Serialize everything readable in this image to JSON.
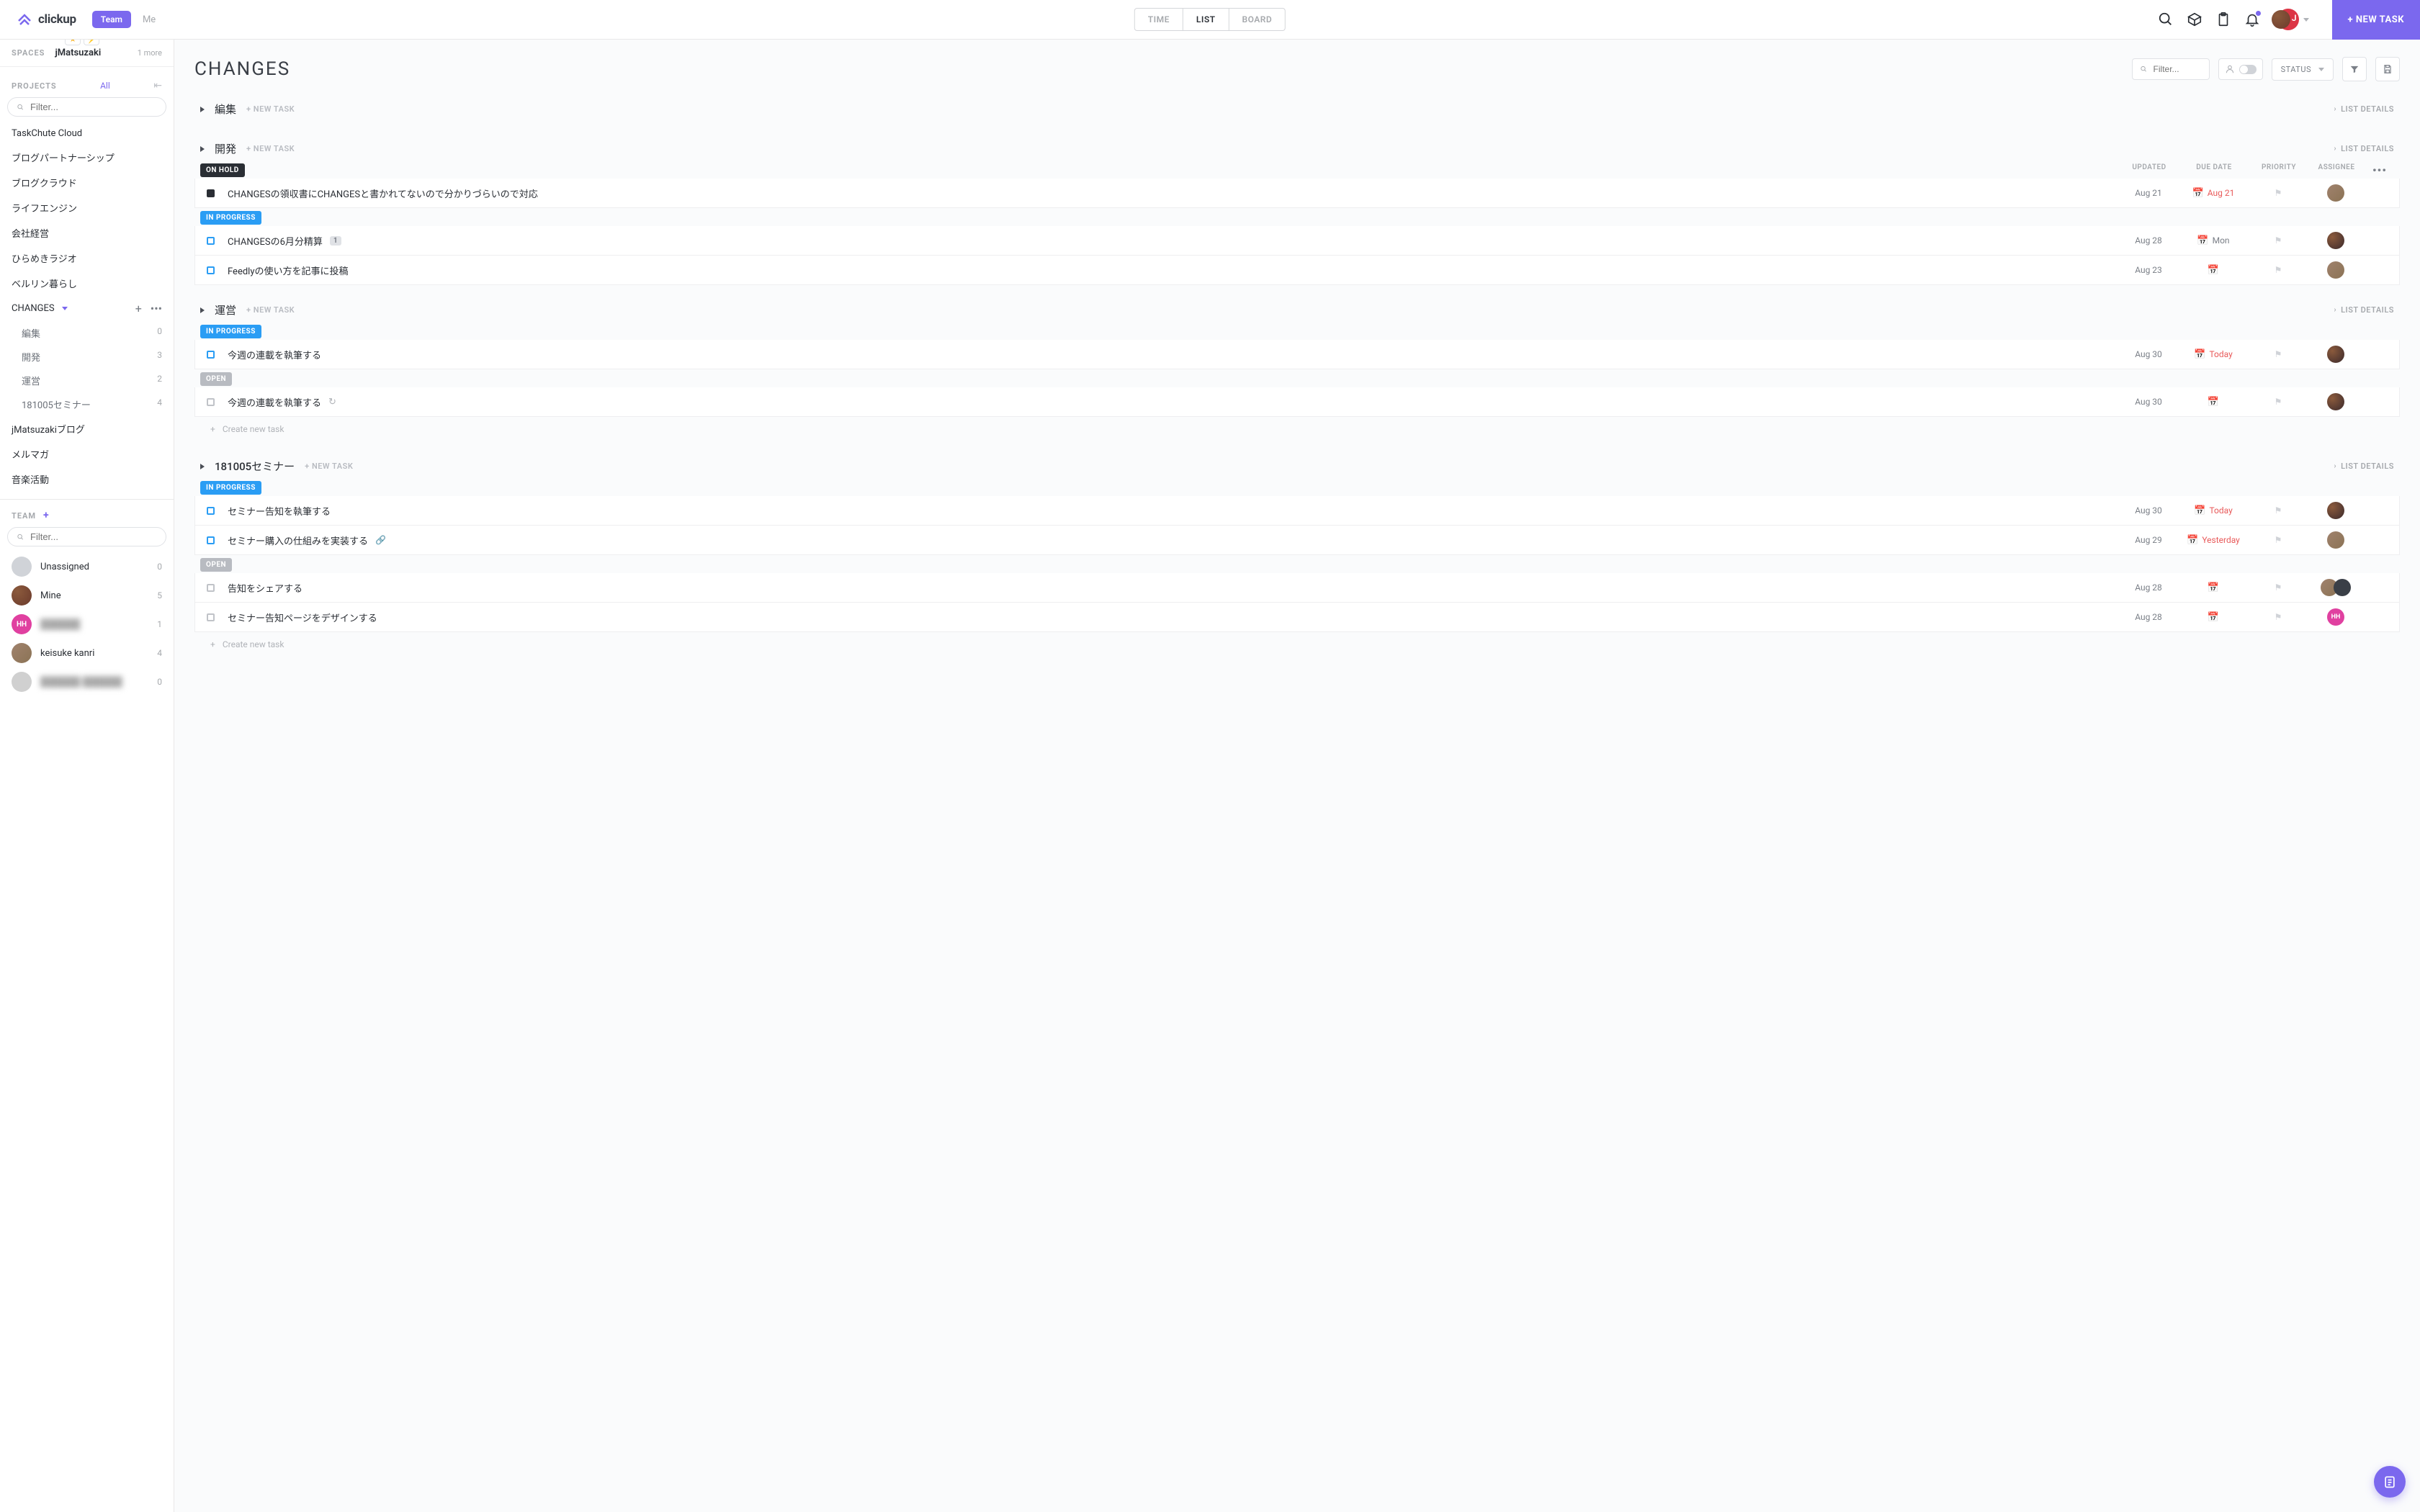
{
  "header": {
    "brand": "clickup",
    "team_pill": "Team",
    "me": "Me",
    "tabs": {
      "time": "TIME",
      "list": "LIST",
      "board": "BOARD"
    },
    "avatar_letter": "J",
    "new_task": "+ NEW TASK"
  },
  "sidebar": {
    "spaces_label": "SPACES",
    "space_name": "jMatsuzaki",
    "more_count": "1 more",
    "projects_label": "PROJECTS",
    "all": "All",
    "filter_placeholder": "Filter...",
    "projects": [
      {
        "name": "TaskChute Cloud"
      },
      {
        "name": "ブログパートナーシップ"
      },
      {
        "name": "ブログクラウド"
      },
      {
        "name": "ライフエンジン"
      },
      {
        "name": "会社経営"
      },
      {
        "name": "ひらめきラジオ"
      },
      {
        "name": "ベルリン暮らし"
      },
      {
        "name": "CHANGES",
        "expanded": true,
        "subs": [
          {
            "name": "編集",
            "count": "0"
          },
          {
            "name": "開発",
            "count": "3"
          },
          {
            "name": "運営",
            "count": "2"
          },
          {
            "name": "181005セミナー",
            "count": "4"
          }
        ]
      },
      {
        "name": "jMatsuzakiブログ"
      },
      {
        "name": "メルマガ"
      },
      {
        "name": "音楽活動"
      }
    ],
    "team_label": "TEAM",
    "team_filter_placeholder": "Filter...",
    "team": [
      {
        "name": "Unassigned",
        "count": "0",
        "avClass": "groups",
        "initials": ""
      },
      {
        "name": "Mine",
        "count": "5",
        "avClass": "red",
        "initials": ""
      },
      {
        "name": "██████",
        "count": "1",
        "avClass": "pink",
        "initials": "HH",
        "blur": true
      },
      {
        "name": "keisuke kanri",
        "count": "4",
        "avClass": "gray1",
        "initials": ""
      },
      {
        "name": "██████ ██████",
        "count": "0",
        "avClass": "gray2",
        "initials": "",
        "blur": true
      }
    ]
  },
  "main": {
    "title": "CHANGES",
    "filter_placeholder": "Filter...",
    "status_label": "STATUS",
    "new_task_text": "+ NEW TASK",
    "list_details": "LIST DETAILS",
    "create_task": "Create new task",
    "columns": {
      "updated": "UPDATED",
      "due": "DUE DATE",
      "priority": "PRIORITY",
      "assignee": "ASSIGNEE"
    },
    "groups": [
      {
        "name": "編集",
        "collapsed": true
      },
      {
        "name": "開発",
        "collapsed": true,
        "blocks": [
          {
            "status": "ON HOLD",
            "statusClass": "onhold",
            "showCols": true,
            "tasks": [
              {
                "name": "CHANGESの領収書にCHANGESと書かれてないので分かりづらいので対応",
                "updated": "Aug 21",
                "due": "Aug 21",
                "dueRed": true,
                "av": "a1"
              }
            ]
          },
          {
            "status": "IN PROGRESS",
            "statusClass": "inprogress",
            "tasks": [
              {
                "name": "CHANGESの6月分精算",
                "badge": "1",
                "updated": "Aug 28",
                "due": "Mon",
                "av": "a2"
              },
              {
                "name": "Feedlyの使い方を記事に投稿",
                "updated": "Aug 23",
                "due": "",
                "av": "a1"
              }
            ]
          }
        ]
      },
      {
        "name": "運営",
        "collapsed": true,
        "blocks": [
          {
            "status": "IN PROGRESS",
            "statusClass": "inprogress",
            "tasks": [
              {
                "name": "今週の連載を執筆する",
                "updated": "Aug 30",
                "due": "Today",
                "dueRed": true,
                "av": "a2"
              }
            ]
          },
          {
            "status": "OPEN",
            "statusClass": "open",
            "tasks": [
              {
                "name": "今週の連載を執筆する",
                "recur": true,
                "updated": "Aug 30",
                "due": "",
                "av": "a2"
              }
            ],
            "createAfter": true
          }
        ]
      },
      {
        "name": "181005セミナー",
        "collapsed": true,
        "blocks": [
          {
            "status": "IN PROGRESS",
            "statusClass": "inprogress",
            "tasks": [
              {
                "name": "セミナー告知を執筆する",
                "updated": "Aug 30",
                "due": "Today",
                "dueRed": true,
                "av": "a2"
              },
              {
                "name": "セミナー購入の仕組みを実装する",
                "link": true,
                "updated": "Aug 29",
                "due": "Yesterday",
                "dueRed": true,
                "av": "a1"
              }
            ]
          },
          {
            "status": "OPEN",
            "statusClass": "open",
            "tasks": [
              {
                "name": "告知をシェアする",
                "updated": "Aug 28",
                "due": "",
                "avs": [
                  "a1",
                  "dark"
                ]
              },
              {
                "name": "セミナー告知ページをデザインする",
                "updated": "Aug 28",
                "due": "",
                "av": "pink",
                "avText": "HH"
              }
            ],
            "createAfter": true
          }
        ]
      }
    ]
  }
}
